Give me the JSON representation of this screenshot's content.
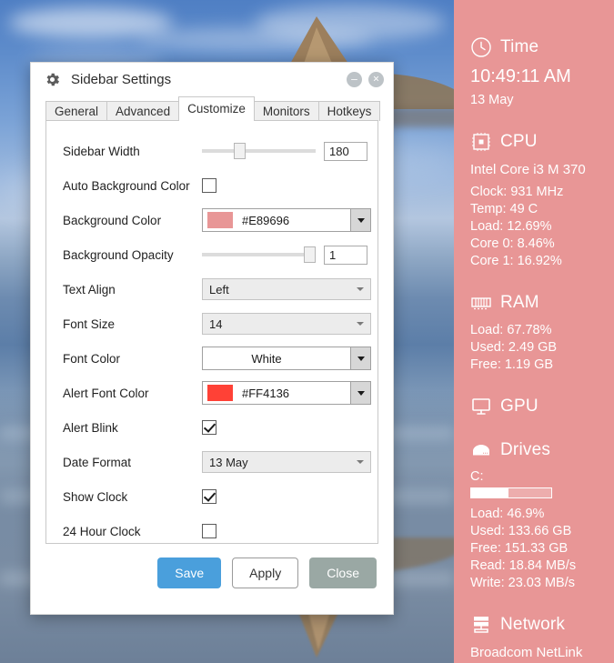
{
  "dialog": {
    "title": "Sidebar Settings",
    "window_buttons": {
      "minimize": "–",
      "close": "×"
    },
    "tabs": [
      {
        "label": "General",
        "active": false
      },
      {
        "label": "Advanced",
        "active": false
      },
      {
        "label": "Customize",
        "active": true
      },
      {
        "label": "Monitors",
        "active": false
      },
      {
        "label": "Hotkeys",
        "active": false
      }
    ],
    "fields": {
      "sidebar_width": {
        "label": "Sidebar Width",
        "value": "180",
        "slider_pct": 33
      },
      "auto_background_color": {
        "label": "Auto Background Color",
        "checked": false
      },
      "background_color": {
        "label": "Background Color",
        "value": "#E89696",
        "swatch": "#E89696"
      },
      "background_opacity": {
        "label": "Background Opacity",
        "value": "1",
        "slider_pct": 100
      },
      "text_align": {
        "label": "Text Align",
        "value": "Left"
      },
      "font_size": {
        "label": "Font Size",
        "value": "14"
      },
      "font_color": {
        "label": "Font Color",
        "value": "White"
      },
      "alert_font_color": {
        "label": "Alert Font Color",
        "value": "#FF4136",
        "swatch": "#FF4136"
      },
      "alert_blink": {
        "label": "Alert Blink",
        "checked": true
      },
      "date_format": {
        "label": "Date Format",
        "value": "13 May"
      },
      "show_clock": {
        "label": "Show Clock",
        "checked": true
      },
      "clock_24h": {
        "label": "24 Hour Clock",
        "checked": false
      }
    },
    "buttons": {
      "save": "Save",
      "apply": "Apply",
      "close": "Close"
    }
  },
  "sidebar": {
    "background_color": "#E89696",
    "font_color": "#FFFFFF",
    "sections": [
      {
        "icon": "clock-icon",
        "title": "Time",
        "primary": "10:49:11 AM",
        "lines": [
          "13 May"
        ]
      },
      {
        "icon": "cpu-icon",
        "title": "CPU",
        "primary": "Intel Core i3 M 370",
        "lines": [
          "Clock: 931 MHz",
          "Temp: 49 C",
          "Load: 12.69%",
          "Core 0: 8.46%",
          "Core 1: 16.92%"
        ]
      },
      {
        "icon": "ram-icon",
        "title": "RAM",
        "primary": "",
        "lines": [
          "Load: 67.78%",
          "Used: 2.49 GB",
          "Free: 1.19 GB"
        ]
      },
      {
        "icon": "gpu-icon",
        "title": "GPU",
        "primary": "",
        "lines": []
      },
      {
        "icon": "drive-icon",
        "title": "Drives",
        "drive_label": "C:",
        "drive_usage_pct": 46.9,
        "lines": [
          "Load: 46.9%",
          "Used: 133.66 GB",
          "Free: 151.33 GB",
          "Read: 18.84 MB/s",
          "Write: 23.03 MB/s"
        ]
      },
      {
        "icon": "network-icon",
        "title": "Network",
        "primary": "Broadcom NetLink",
        "lines": []
      }
    ]
  }
}
